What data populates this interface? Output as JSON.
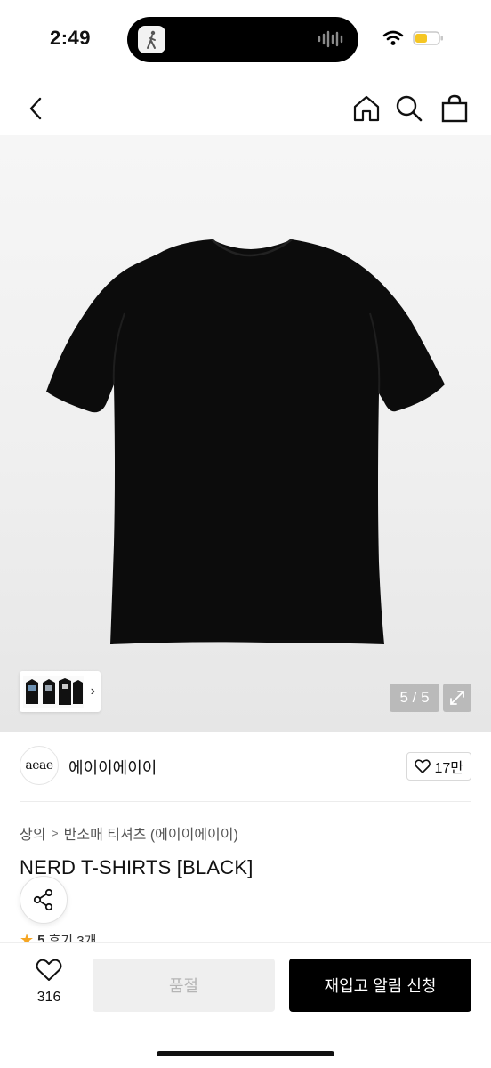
{
  "status_bar": {
    "time": "2:49",
    "icons": [
      "wifi-icon",
      "battery-icon"
    ],
    "battery_color": "#f5c623"
  },
  "nav": {
    "icons": [
      "back-icon",
      "home-icon",
      "search-icon",
      "bag-icon"
    ]
  },
  "gallery": {
    "page_indicator": "5 / 5",
    "current_page": 5,
    "total_pages": 5,
    "thumb_arrow": "›"
  },
  "brand": {
    "logo_text": "aeae",
    "name": "에이이에이이",
    "likes": "17만"
  },
  "product": {
    "breadcrumb": [
      "상의",
      "반소매 티셔츠 (에이이에이이)"
    ],
    "title": "NERD T-SHIRTS [BLACK]",
    "rating_value": "5",
    "reviews_label": "후기 3개"
  },
  "bottom_bar": {
    "wish_count": "316",
    "soldout_label": "품절",
    "restock_label": "재입고 알림 신청"
  },
  "colors": {
    "primary_button": "#000000",
    "disabled_button": "#efefef",
    "star": "#f5a623"
  }
}
